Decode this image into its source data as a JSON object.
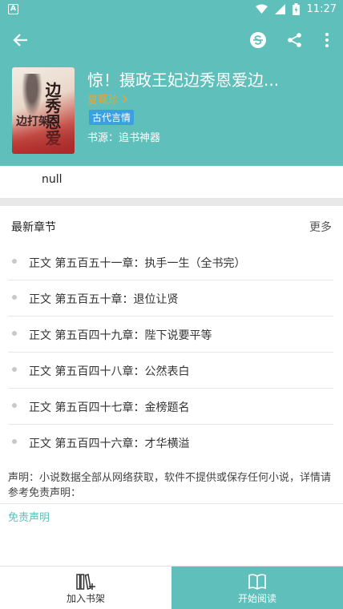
{
  "status_bar": {
    "left_badge": "A",
    "time": "11:27"
  },
  "book": {
    "title": "惊！摄政王妃边秀恩爱边...",
    "author": "夏珮珍",
    "category_tag": "古代言情",
    "source": "书源：追书神器",
    "cover_text": "边秀恩爱",
    "cover_text_small": "边打架"
  },
  "intro": {
    "text": "null"
  },
  "chapters_section": {
    "heading": "最新章节",
    "more_label": "更多",
    "items": [
      "正文 第五百五十一章：执手一生（全书完）",
      "正文 第五百五十章：退位让贤",
      "正文 第五百四十九章：陛下说要平等",
      "正文 第五百四十八章：公然表白",
      "正文 第五百四十七章：金榜题名",
      "正文 第五百四十六章：才华横溢"
    ]
  },
  "disclaimer": {
    "text": "声明：小说数据全部从网络获取，软件不提供或保存任何小说，详情请参考免责声明：",
    "link": "免责声明"
  },
  "bottom_bar": {
    "add_shelf": "加入书架",
    "start_reading": "开始阅读"
  },
  "colors": {
    "primary": "#5fbfba",
    "author": "#e9a437",
    "tag": "#3aa0e0"
  },
  "icons": {
    "back": "arrow-left-icon",
    "strike": "strikethrough-circle-icon",
    "share": "share-icon",
    "more": "more-vertical-icon",
    "wifi": "wifi-icon",
    "battery": "battery-icon",
    "signal": "signal-icon",
    "bookshelf": "bookshelf-icon",
    "book_open": "book-open-icon"
  }
}
